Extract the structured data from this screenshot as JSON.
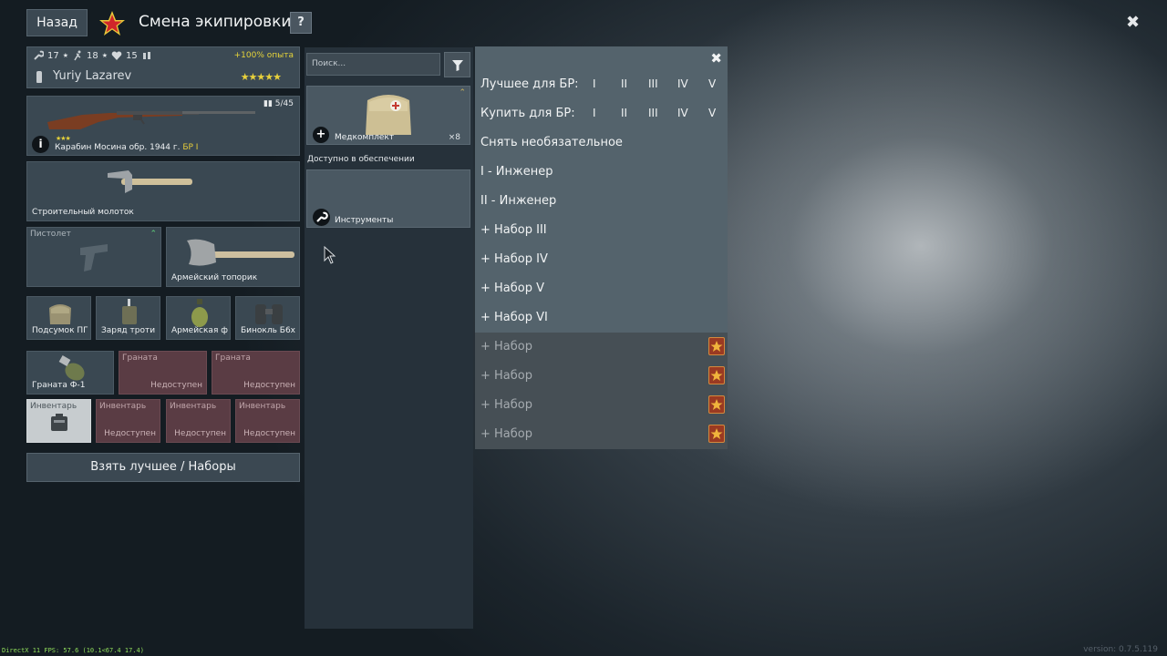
{
  "header": {
    "back_label": "Назад",
    "title": "Смена экипировки",
    "help_label": "?",
    "close_label": "✖"
  },
  "soldier": {
    "stats": [
      "17",
      "18",
      "15"
    ],
    "exp_bonus": "+100% опыта",
    "name": "Yuriy Lazarev",
    "rank_stars": "★★★★★"
  },
  "loadout": {
    "rifle": {
      "name": "Карабин Мосина обр. 1944 г.",
      "br": "БР I",
      "ammo": "5/45",
      "stars": "★★★"
    },
    "melee_tool": {
      "name": "Строительный молоток"
    },
    "pistol": {
      "slot_label": "Пистолет"
    },
    "axe": {
      "name": "Армейский топорик"
    },
    "small_items": [
      "Подсумок ПГ",
      "Заряд троти",
      "Армейская ф",
      "Бинокль Б6х"
    ],
    "grenades": [
      {
        "name": "Граната Ф-1"
      },
      {
        "slot_label": "Граната",
        "status": "Недоступен"
      },
      {
        "slot_label": "Граната",
        "status": "Недоступен"
      }
    ],
    "inventory": [
      {
        "slot_label": "Инвентарь"
      },
      {
        "slot_label": "Инвентарь",
        "status": "Недоступен"
      },
      {
        "slot_label": "Инвентарь",
        "status": "Недоступен"
      },
      {
        "slot_label": "Инвентарь",
        "status": "Недоступен"
      }
    ],
    "best_button": "Взять лучшее / Наборы"
  },
  "picker": {
    "search_placeholder": "Поиск...",
    "items": [
      {
        "name": "Медкомплект",
        "count": "×8"
      }
    ],
    "section_label": "Доступно в обеспечении",
    "supply_items": [
      {
        "name": "Инструменты"
      }
    ]
  },
  "presets": {
    "close_label": "✖",
    "best_label": "Лучшее для БР:",
    "buy_label": "Купить для БР:",
    "br_levels": [
      "I",
      "II",
      "III",
      "IV",
      "V"
    ],
    "remove_optional": "Снять необязательное",
    "items": [
      "I - Инженер",
      "II - Инженер",
      "+ Набор III",
      "+ Набор IV",
      "+ Набор V",
      "+ Набор VI"
    ],
    "locked_items": [
      "+ Набор",
      "+ Набор",
      "+ Набор",
      "+ Набор"
    ]
  },
  "footer": {
    "fps": "DirectX 11 FPS: 57.6 (10.1<67.4 17.4)",
    "version": "version: 0.7.5.119"
  },
  "colors": {
    "accent_yellow": "#e5cc3a",
    "unavailable_slot": "#5a3c44",
    "fps_green": "#8fdc5b"
  }
}
